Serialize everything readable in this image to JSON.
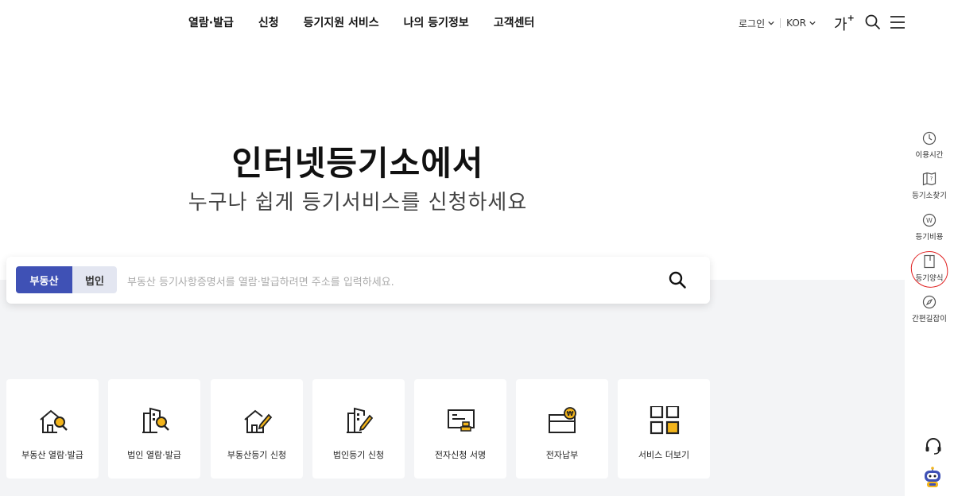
{
  "nav": {
    "items": [
      "열람·발급",
      "신청",
      "등기지원 서비스",
      "나의 등기정보",
      "고객센터"
    ]
  },
  "util": {
    "login_label": "로그인",
    "lang_label": "KOR",
    "font_size_label": "가",
    "font_size_plus": "+"
  },
  "hero": {
    "title": "인터넷등기소에서",
    "subtitle": "누구나 쉽게 등기서비스를 신청하세요"
  },
  "search": {
    "tab_realestate": "부동산",
    "tab_corporation": "법인",
    "placeholder": "부동산 등기사항증명서를 열람·발급하려면 주소를 입력하세요."
  },
  "services": [
    {
      "label": "부동산 열람·발급",
      "icon": "house-search-icon"
    },
    {
      "label": "법인 열람·발급",
      "icon": "building-search-icon"
    },
    {
      "label": "부동산등기 신청",
      "icon": "house-edit-icon"
    },
    {
      "label": "법인등기 신청",
      "icon": "building-edit-icon"
    },
    {
      "label": "전자신청 서명",
      "icon": "e-sign-icon"
    },
    {
      "label": "전자납부",
      "icon": "e-payment-icon"
    },
    {
      "label": "서비스 더보기",
      "icon": "grid-more-icon"
    }
  ],
  "quick_menu": [
    {
      "label": "이용시간",
      "icon": "clock-icon"
    },
    {
      "label": "등기소찾기",
      "icon": "map-icon"
    },
    {
      "label": "등기비용",
      "icon": "won-coin-icon"
    },
    {
      "label": "등기양식",
      "icon": "form-document-icon"
    },
    {
      "label": "간편길잡이",
      "icon": "compass-icon"
    }
  ],
  "colors": {
    "accent": "#3f51b5",
    "tab_inactive": "#e3e6f1",
    "icon_highlight": "#f2b41b",
    "annotation": "#e02020"
  }
}
